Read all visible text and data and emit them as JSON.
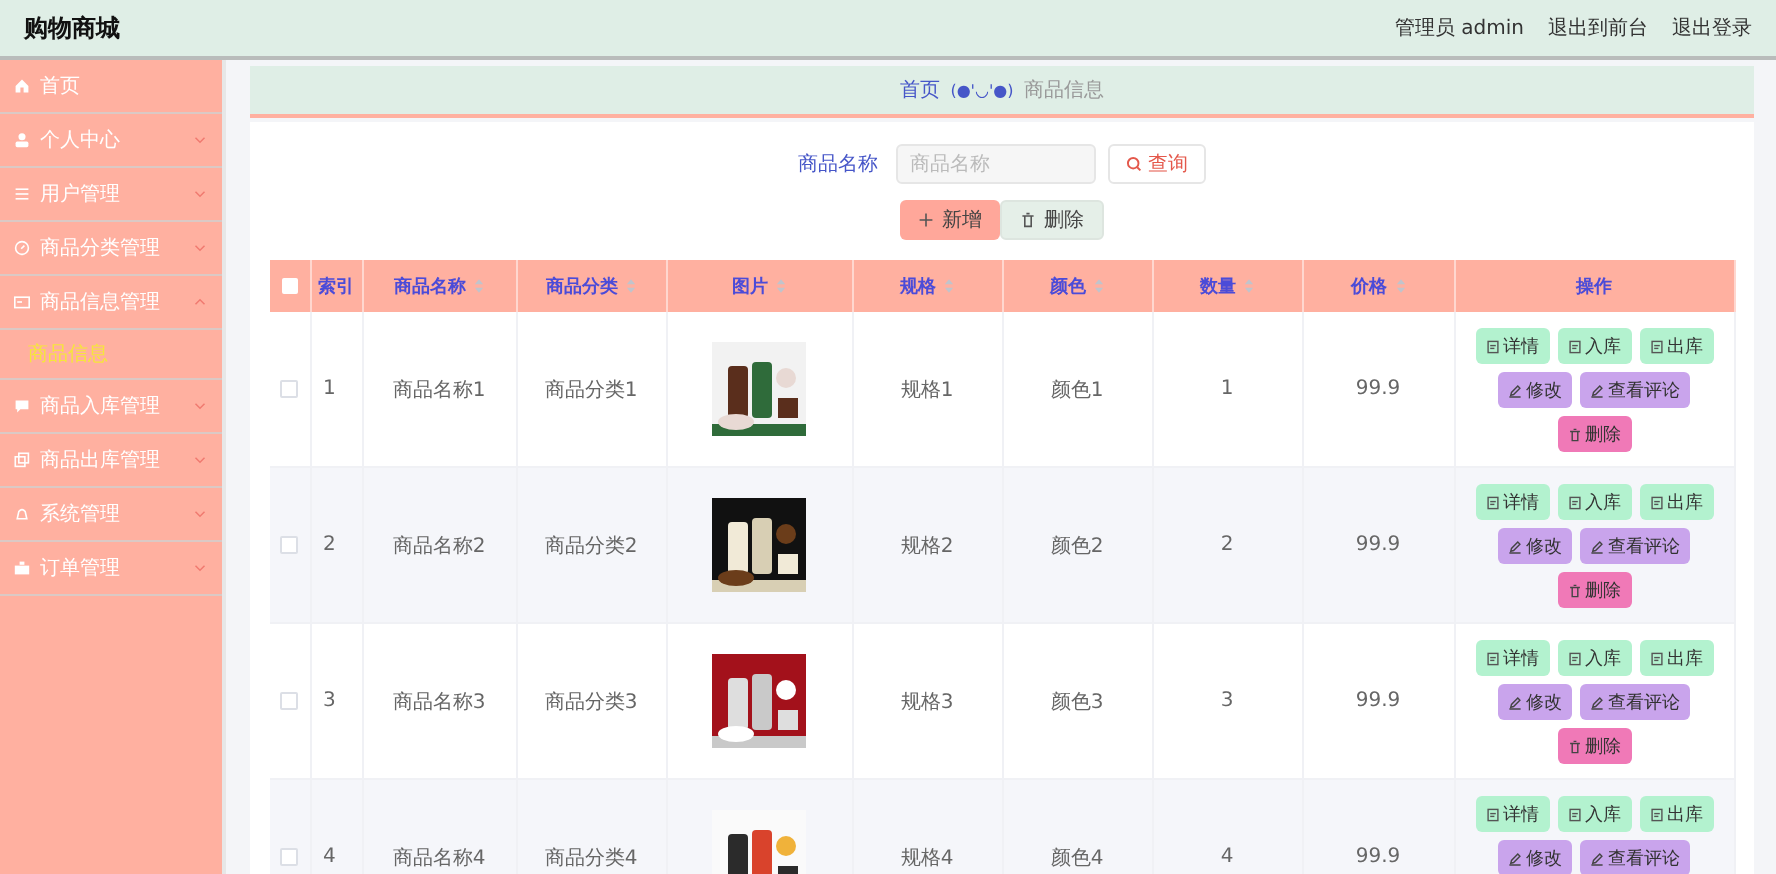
{
  "header": {
    "title": "购物商城",
    "links": [
      "管理员 admin",
      "退出到前台",
      "退出登录"
    ]
  },
  "sidebar": {
    "items": [
      {
        "label": "首页",
        "kind": "link"
      },
      {
        "label": "个人中心",
        "kind": "group",
        "expanded": false
      },
      {
        "label": "用户管理",
        "kind": "group",
        "expanded": false
      },
      {
        "label": "商品分类管理",
        "kind": "group",
        "expanded": false
      },
      {
        "label": "商品信息管理",
        "kind": "group",
        "expanded": true,
        "children": [
          {
            "label": "商品信息",
            "selected": true
          }
        ]
      },
      {
        "label": "商品入库管理",
        "kind": "group",
        "expanded": false
      },
      {
        "label": "商品出库管理",
        "kind": "group",
        "expanded": false
      },
      {
        "label": "系统管理",
        "kind": "group",
        "expanded": false
      },
      {
        "label": "订单管理",
        "kind": "group",
        "expanded": false
      }
    ]
  },
  "breadcrumb": {
    "home": "首页",
    "separator": "(●'◡'●)",
    "current": "商品信息"
  },
  "search": {
    "label": "商品名称",
    "placeholder": "商品名称",
    "button": "查询"
  },
  "toolbar": [
    {
      "label": "新增",
      "kind": "add"
    },
    {
      "label": "删除",
      "kind": "delete"
    }
  ],
  "table": {
    "all_checked": false,
    "columns": [
      {
        "kind": "checkbox"
      },
      {
        "label": "索引",
        "sortable": false
      },
      {
        "label": "商品名称",
        "sortable": true
      },
      {
        "label": "商品分类",
        "sortable": true
      },
      {
        "label": "图片",
        "sortable": true
      },
      {
        "label": "规格",
        "sortable": true
      },
      {
        "label": "颜色",
        "sortable": true
      },
      {
        "label": "数量",
        "sortable": true
      },
      {
        "label": "价格",
        "sortable": true
      },
      {
        "label": "操作",
        "sortable": false
      }
    ],
    "rows": [
      {
        "checked": false,
        "index": "1",
        "name": "商品名称1",
        "category": "商品分类1",
        "image": {
          "kind": "picture"
        },
        "spec": "规格1",
        "color_label": "颜色1",
        "quantity": "1",
        "price": "99.9",
        "actions": [
          {
            "label": "详情",
            "kind": "info"
          },
          {
            "label": "入库",
            "kind": "info"
          },
          {
            "label": "出库",
            "kind": "info"
          },
          {
            "label": "修改",
            "kind": "edit"
          },
          {
            "label": "查看评论",
            "kind": "edit"
          },
          {
            "label": "删除",
            "kind": "delete"
          }
        ]
      },
      {
        "checked": false,
        "index": "2",
        "name": "商品名称2",
        "category": "商品分类2",
        "image": {
          "kind": "picture"
        },
        "spec": "规格2",
        "color_label": "颜色2",
        "quantity": "2",
        "price": "99.9",
        "actions": [
          {
            "label": "详情",
            "kind": "info"
          },
          {
            "label": "入库",
            "kind": "info"
          },
          {
            "label": "出库",
            "kind": "info"
          },
          {
            "label": "修改",
            "kind": "edit"
          },
          {
            "label": "查看评论",
            "kind": "edit"
          },
          {
            "label": "删除",
            "kind": "delete"
          }
        ]
      },
      {
        "checked": false,
        "index": "3",
        "name": "商品名称3",
        "category": "商品分类3",
        "image": {
          "kind": "picture"
        },
        "spec": "规格3",
        "color_label": "颜色3",
        "quantity": "3",
        "price": "99.9",
        "actions": [
          {
            "label": "详情",
            "kind": "info"
          },
          {
            "label": "入库",
            "kind": "info"
          },
          {
            "label": "出库",
            "kind": "info"
          },
          {
            "label": "修改",
            "kind": "edit"
          },
          {
            "label": "查看评论",
            "kind": "edit"
          },
          {
            "label": "删除",
            "kind": "delete"
          }
        ]
      },
      {
        "checked": false,
        "index": "4",
        "name": "商品名称4",
        "category": "商品分类4",
        "image": {
          "kind": "picture"
        },
        "spec": "规格4",
        "color_label": "颜色4",
        "quantity": "4",
        "price": "99.9",
        "actions": [
          {
            "label": "详情",
            "kind": "info"
          },
          {
            "label": "入库",
            "kind": "info"
          },
          {
            "label": "出库",
            "kind": "info"
          },
          {
            "label": "修改",
            "kind": "edit"
          },
          {
            "label": "查看评论",
            "kind": "edit"
          }
        ]
      }
    ]
  }
}
